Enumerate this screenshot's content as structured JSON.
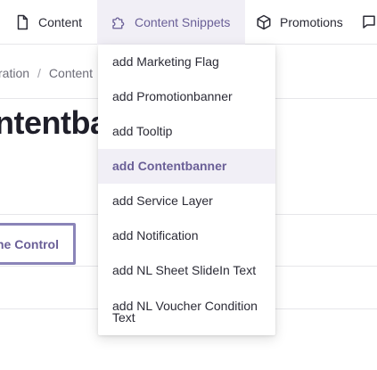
{
  "nav": {
    "items": [
      {
        "label": "Content",
        "icon": "document-icon"
      },
      {
        "label": "Content Snippets",
        "icon": "puzzle-icon"
      },
      {
        "label": "Promotions",
        "icon": "box-icon"
      }
    ]
  },
  "breadcrumb": {
    "items": [
      "ration",
      "Content"
    ]
  },
  "page": {
    "title": "ntentban",
    "control_button": "ne Control"
  },
  "dropdown": {
    "items": [
      {
        "label": "add Marketing Flag"
      },
      {
        "label": "add Promotionbanner"
      },
      {
        "label": "add Tooltip"
      },
      {
        "label": "add Contentbanner",
        "active": true
      },
      {
        "label": "add Service Layer"
      },
      {
        "label": "add Notification"
      },
      {
        "label": "add NL Sheet SlideIn Text"
      },
      {
        "label": "add NL Voucher Condition Text"
      }
    ]
  },
  "colors": {
    "accent": "#6a5f97",
    "active_bg": "#f1eff6",
    "text": "#2b2b36"
  }
}
